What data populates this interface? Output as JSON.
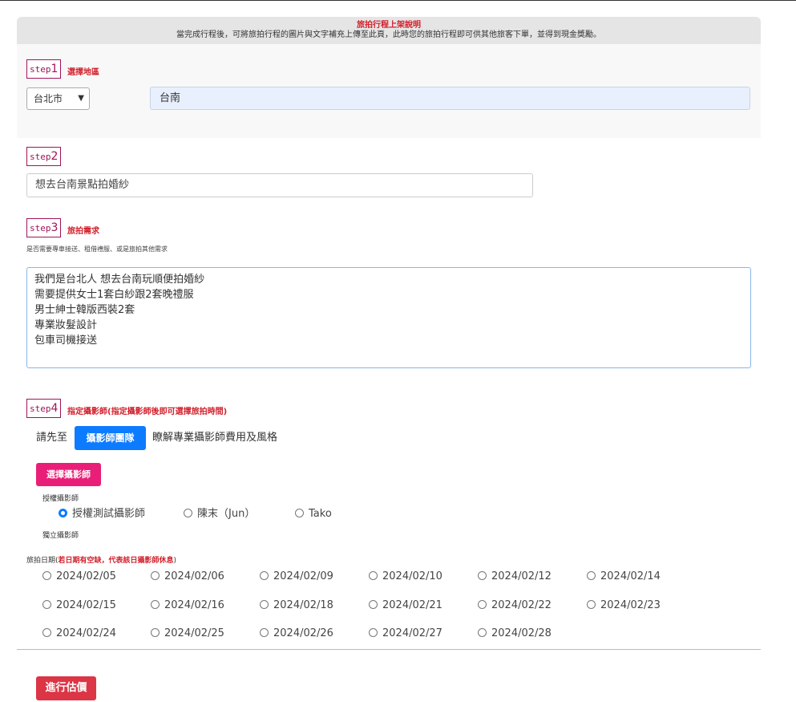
{
  "notice": {
    "title": "旅拍行程上架說明",
    "text": "當完成行程後，可將旅拍行程的圖片與文字補充上傳至此頁，此時您的旅拍行程即可供其他旅客下單，並得到現金獎勵。"
  },
  "steps": [
    {
      "prefix": "step",
      "num": "1",
      "title": "選擇地區"
    },
    {
      "prefix": "step",
      "num": "2",
      "title": ""
    },
    {
      "prefix": "step",
      "num": "3",
      "title": "旅拍需求"
    },
    {
      "prefix": "step",
      "num": "4",
      "title": "指定攝影師(指定攝影師後即可選擇旅拍時間)"
    }
  ],
  "region": {
    "city_selected": "台北市",
    "area_value": "台南"
  },
  "step2": {
    "value": "想去台南景點拍婚紗"
  },
  "step3": {
    "hint": "是否需要專車接送、租借禮服、或是旅拍其他需求",
    "lines": [
      "我們是台北人 想去台南玩順便拍婚紗",
      "需要提供女士1套白紗跟2套晚禮服",
      "男士紳士韓版西裝2套",
      "專業妝髮設計",
      "包車司機接送"
    ]
  },
  "step4": {
    "lead_pre": "請先至",
    "team_button": "攝影師團隊",
    "lead_post": "瞭解專業攝影師費用及風格",
    "choose_button": "選擇攝影師",
    "authorized_label": "授權攝影師",
    "photographers": [
      {
        "name": "授權測試攝影師",
        "checked": true
      },
      {
        "name": "陳末（Jun）",
        "checked": false
      },
      {
        "name": "Tako",
        "checked": false
      }
    ],
    "independent_label": "獨立攝影師"
  },
  "dates": {
    "label_prefix": "旅拍日期(",
    "label_red": "若日期有空缺，代表該日攝影師休息",
    "label_suffix": ")",
    "options": [
      "2024/02/05",
      "2024/02/06",
      "2024/02/09",
      "2024/02/10",
      "2024/02/12",
      "2024/02/14",
      "2024/02/15",
      "2024/02/16",
      "2024/02/18",
      "2024/02/21",
      "2024/02/22",
      "2024/02/23",
      "2024/02/24",
      "2024/02/25",
      "2024/02/26",
      "2024/02/27",
      "2024/02/28"
    ]
  },
  "submit": {
    "label": "進行估價"
  },
  "colors": {
    "accent_red": "#d21f2b",
    "step_border": "#a0145a",
    "primary_blue": "#0d7bff",
    "pink": "#e91e78",
    "danger": "#dc3545"
  }
}
